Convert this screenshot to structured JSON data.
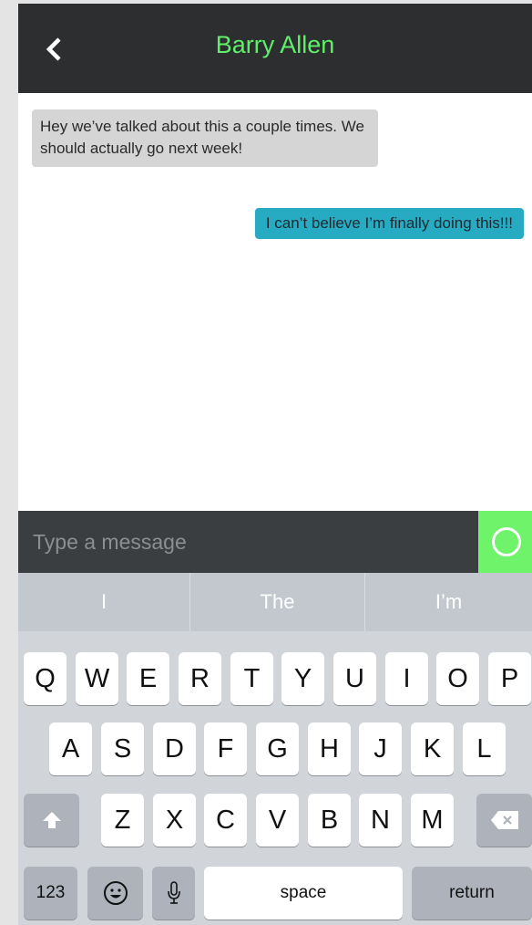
{
  "header": {
    "title": "Barry Allen"
  },
  "messages": [
    {
      "direction": "incoming",
      "text": "Hey we’ve talked about this a couple times. We should actually go next week!"
    },
    {
      "direction": "outgoing",
      "text": "I can’t believe I’m finally doing this!!!"
    }
  ],
  "composer": {
    "placeholder": "Type a message",
    "value": ""
  },
  "keyboard": {
    "suggestions": [
      "I",
      "The",
      "I’m"
    ],
    "row1": [
      "Q",
      "W",
      "E",
      "R",
      "T",
      "Y",
      "U",
      "I",
      "O",
      "P"
    ],
    "row2": [
      "A",
      "S",
      "D",
      "F",
      "G",
      "H",
      "J",
      "K",
      "L"
    ],
    "row3": [
      "Z",
      "X",
      "C",
      "V",
      "B",
      "N",
      "M"
    ],
    "numbers_label": "123",
    "space_label": "space",
    "return_label": "return"
  },
  "colors": {
    "header_bg": "#2c2e30",
    "title_color": "#5ff06a",
    "incoming_bubble": "#d5d5d5",
    "outgoing_bubble": "#27abc3",
    "send_button": "#6ff36b"
  },
  "icons": [
    "back-chevron-icon",
    "send-circle-icon",
    "shift-icon",
    "emoji-icon",
    "microphone-icon",
    "backspace-icon"
  ]
}
